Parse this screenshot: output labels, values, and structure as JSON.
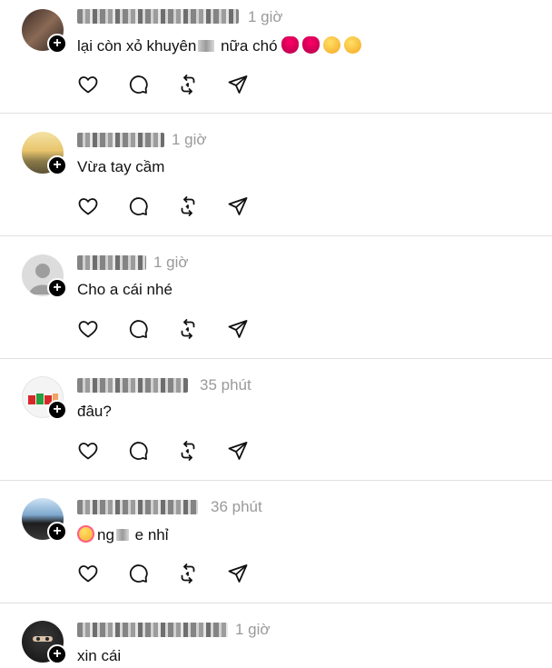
{
  "comments": [
    {
      "time": "1 giờ",
      "text_before": "lại còn xỏ khuyên",
      "text_after": " nữa chó",
      "emojis": [
        "tongue-emoji",
        "tongue-emoji",
        "winking-tongue-emoji",
        "yum-emoji"
      ]
    },
    {
      "time": "1 giờ",
      "text_before": "Vừa tay cầm",
      "text_after": "",
      "emojis": []
    },
    {
      "time": "1 giờ",
      "text_before": "Cho a cái nhé",
      "text_after": "",
      "emojis": []
    },
    {
      "time": "35 phút",
      "text_before": "đâu?",
      "text_after": "",
      "emojis": []
    },
    {
      "time": "36 phút",
      "text_before": "ng",
      "text_after": " e nhỉ",
      "emojis": [
        "smiling-hearts-emoji"
      ]
    },
    {
      "time": "1 giờ",
      "text_before": "xin cái",
      "text_after": "",
      "emojis": []
    }
  ],
  "actions": [
    "like-icon",
    "reply-icon",
    "repost-icon",
    "share-icon"
  ],
  "colors": {
    "timestamp": "#9a9a9a",
    "divider": "#e0e0e0",
    "text": "#111111"
  }
}
